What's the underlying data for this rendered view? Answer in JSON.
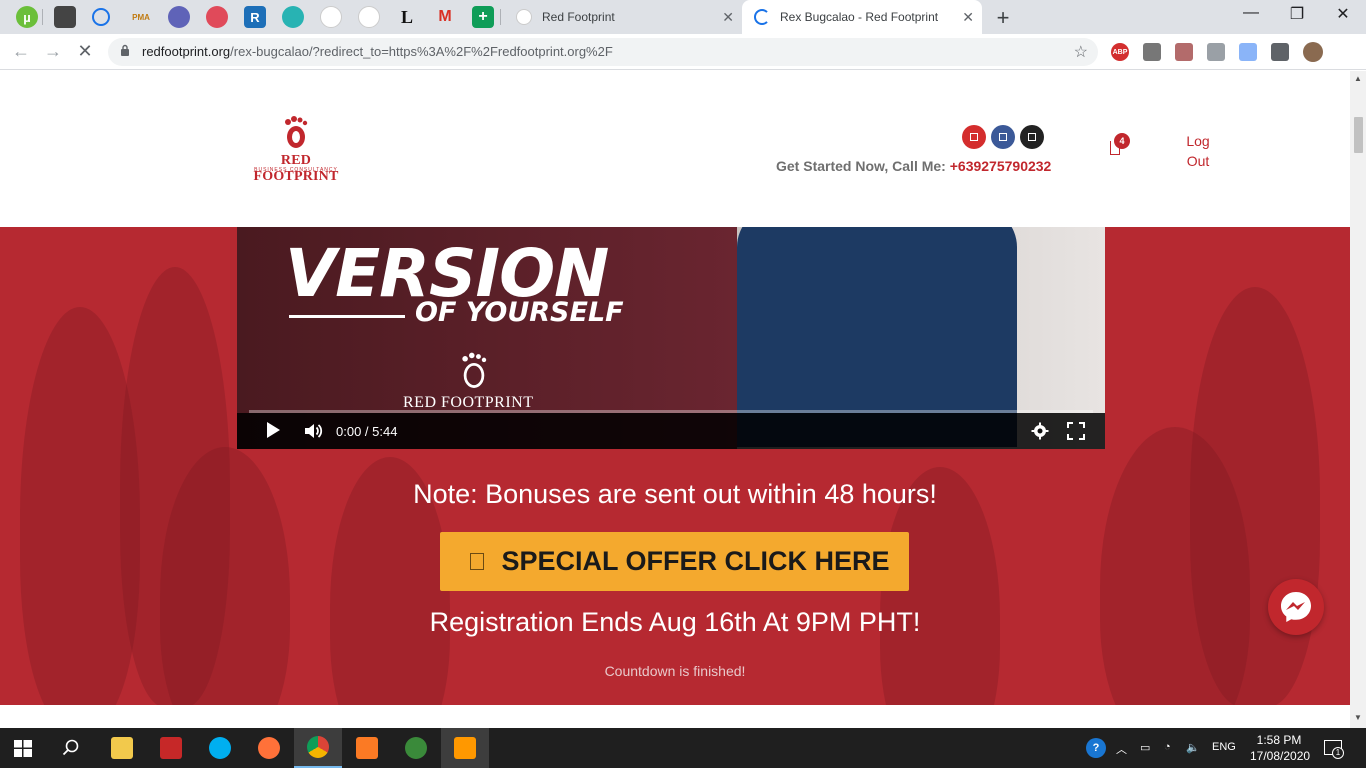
{
  "browser": {
    "tabs": [
      {
        "title": "Red Footprint",
        "active": false
      },
      {
        "title": "Rex Bugcalao - Red Footprint",
        "active": true
      }
    ],
    "url_host": "redfootprint.org",
    "url_path": "/rex-bugcalao/?redirect_to=https%3A%2F%2Fredfootprint.org%2F",
    "pinned_icons": [
      "utorrent-icon",
      "media-icon",
      "feed-icon",
      "pma-icon",
      "settings-site-icon",
      "heart-site-icon",
      "r-site-icon",
      "task-site-icon",
      "redfootprint-site-icon",
      "redfootprint-site-icon-2",
      "l-site-icon",
      "gmail-icon",
      "sheets-icon"
    ],
    "pma_label": "PMA",
    "l_label": "L",
    "m_label": "M",
    "r_label": "R",
    "extensions": [
      "adblock-icon",
      "eyedropper-icon",
      "pdf-icon",
      "download-icon",
      "download-alt-icon",
      "puzzle-icon",
      "profile-avatar"
    ],
    "adblock_label": "ABP"
  },
  "site": {
    "logo_text": "RED FOOTPRINT",
    "logo_sub": "BUSINESS CONSULTANCY",
    "call_label": "Get Started Now, Call Me: ",
    "phone": "+639275790232",
    "cart_count": "4",
    "logout_line1": "Log",
    "logout_line2": "Out",
    "social_colors": [
      "#d42d2d",
      "#3b5998",
      "#222222"
    ]
  },
  "video": {
    "headline_big": "VERSION",
    "headline_small": "OF YOURSELF",
    "brand": "RED FOOTPRINT",
    "time": "0:00 / 5:44"
  },
  "hero": {
    "note": "Note: Bonuses are sent out within 48 hours!",
    "cta_label": "SPECIAL OFFER CLICK HERE",
    "registration": "Registration Ends Aug 16th At 9PM PHT!",
    "countdown": "Countdown is finished!"
  },
  "taskbar": {
    "apps": [
      "file-explorer-icon",
      "filezilla-icon",
      "skype-icon",
      "firefox-icon",
      "chrome-icon",
      "xampp-icon",
      "photos-icon",
      "sublime-icon"
    ],
    "lang": "ENG",
    "time": "1:58 PM",
    "date": "17/08/2020",
    "notif_count": "1"
  },
  "colors": {
    "brand_red": "#c1272d",
    "cta_orange": "#f4a92e"
  }
}
